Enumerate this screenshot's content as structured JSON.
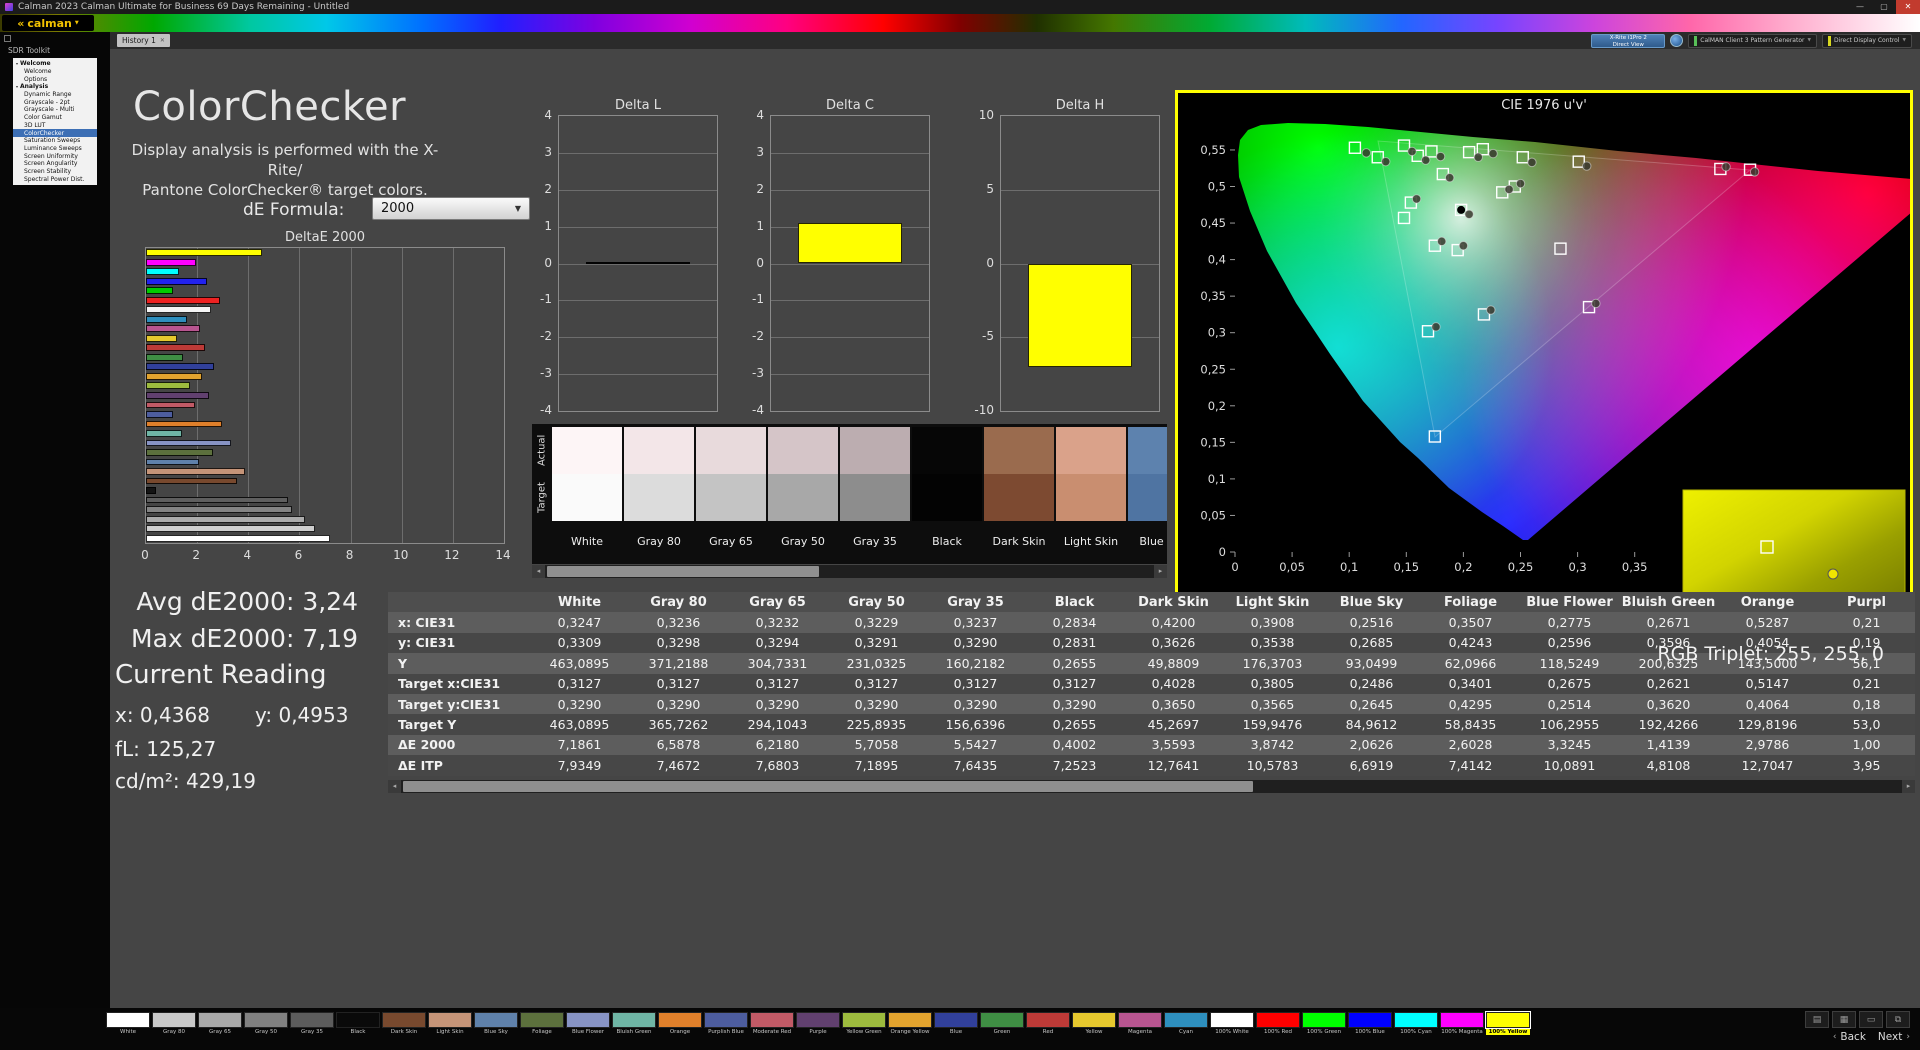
{
  "window": {
    "title": "Calman 2023 Calman Ultimate for Business 69 Days Remaining  -  Untitled",
    "minimize": "—",
    "maximize": "▢",
    "close": "✕",
    "logo_mark": "«",
    "logo_text": "calman",
    "logo_caret": "▼"
  },
  "sidebar": {
    "title": "SDR Toolkit",
    "tree": [
      {
        "label": "Welcome",
        "type": "section"
      },
      {
        "label": "Welcome",
        "type": "item"
      },
      {
        "label": "Options",
        "type": "item"
      },
      {
        "label": "Analysis",
        "type": "section"
      },
      {
        "label": "Dynamic Range",
        "type": "item"
      },
      {
        "label": "Grayscale - 2pt",
        "type": "item"
      },
      {
        "label": "Grayscale - Multi",
        "type": "item"
      },
      {
        "label": "Color Gamut",
        "type": "item"
      },
      {
        "label": "3D LUT",
        "type": "item"
      },
      {
        "label": "ColorChecker",
        "type": "item",
        "selected": true
      },
      {
        "label": "Saturation Sweeps",
        "type": "item"
      },
      {
        "label": "Luminance Sweeps",
        "type": "item"
      },
      {
        "label": "Screen Uniformity",
        "type": "item"
      },
      {
        "label": "Screen Angularity",
        "type": "item"
      },
      {
        "label": "Screen Stability",
        "type": "item"
      },
      {
        "label": "Spectral Power Dist.",
        "type": "item"
      }
    ]
  },
  "topbar": {
    "tab": "History 1",
    "tab_close": "✕",
    "meter_line1": "X-Rite i1Pro 2",
    "meter_line2": "Direct View",
    "source_label": "CalMAN Client 3 Pattern Generator",
    "display_label": "Direct Display Control",
    "caret": "▼"
  },
  "page": {
    "title": "ColorChecker",
    "desc1": "Display analysis is performed with the X-Rite/",
    "desc2": "Pantone ColorChecker® target colors.",
    "formula_label": "dE Formula:",
    "formula_value": "2000",
    "formula_caret": "▼",
    "avg": "Avg dE2000: 3,24",
    "max": "Max dE2000: 7,19",
    "reading_title": "Current Reading",
    "reading_x": "x: 0,4368",
    "reading_y": "y: 0,4953",
    "reading_fl": "fL: 125,27",
    "reading_cd": "cd/m²: 429,19"
  },
  "chart_data": [
    {
      "id": "deltae2000",
      "type": "bar",
      "orientation": "horizontal",
      "title": "DeltaE 2000",
      "xlim": [
        0,
        14
      ],
      "xticks": [
        "0",
        "2",
        "4",
        "6",
        "8",
        "10",
        "12",
        "14"
      ],
      "bars": [
        {
          "name": "100% Yellow",
          "value": 4.55,
          "color": "#ffff00"
        },
        {
          "name": "100% Magenta",
          "value": 1.95,
          "color": "#ff00ff"
        },
        {
          "name": "100% Cyan",
          "value": 1.3,
          "color": "#00ffff"
        },
        {
          "name": "100% Blue",
          "value": 2.4,
          "color": "#2222ee"
        },
        {
          "name": "100% Green",
          "value": 1.05,
          "color": "#00cc00"
        },
        {
          "name": "100% Red",
          "value": 2.9,
          "color": "#ee2222"
        },
        {
          "name": "100% White",
          "value": 2.55,
          "color": "#f5f5f5"
        },
        {
          "name": "Cyan",
          "value": 1.6,
          "color": "#2e8fbe"
        },
        {
          "name": "Magenta",
          "value": 2.1,
          "color": "#b85590"
        },
        {
          "name": "Yellow",
          "value": 1.2,
          "color": "#e6c82e"
        },
        {
          "name": "Red",
          "value": 2.3,
          "color": "#bd3a37"
        },
        {
          "name": "Green",
          "value": 1.45,
          "color": "#3f8e44"
        },
        {
          "name": "Blue",
          "value": 2.65,
          "color": "#31409b"
        },
        {
          "name": "Orange Yellow",
          "value": 2.2,
          "color": "#e2a32e"
        },
        {
          "name": "Yellow Green",
          "value": 1.7,
          "color": "#9dbb3e"
        },
        {
          "name": "Purple",
          "value": 2.45,
          "color": "#61406f"
        },
        {
          "name": "Moderate Red",
          "value": 1.9,
          "color": "#c15a66"
        },
        {
          "name": "Purplish Blue",
          "value": 1.05,
          "color": "#4d5d9f"
        },
        {
          "name": "Orange",
          "value": 2.98,
          "color": "#e0802b"
        },
        {
          "name": "Bluish Green",
          "value": 1.41,
          "color": "#6fb5a5"
        },
        {
          "name": "Blue Flower",
          "value": 3.32,
          "color": "#8793c4"
        },
        {
          "name": "Foliage",
          "value": 2.6,
          "color": "#5c703d"
        },
        {
          "name": "Blue Sky",
          "value": 2.06,
          "color": "#5f81aa"
        },
        {
          "name": "Light Skin",
          "value": 3.87,
          "color": "#c59478"
        },
        {
          "name": "Dark Skin",
          "value": 3.56,
          "color": "#78492e"
        },
        {
          "name": "Black",
          "value": 0.4,
          "color": "#141414"
        },
        {
          "name": "Gray 35",
          "value": 5.54,
          "color": "#5f5f5f"
        },
        {
          "name": "Gray 50",
          "value": 5.71,
          "color": "#848484"
        },
        {
          "name": "Gray 65",
          "value": 6.22,
          "color": "#ababab"
        },
        {
          "name": "Gray 80",
          "value": 6.59,
          "color": "#cecece"
        },
        {
          "name": "White",
          "value": 7.19,
          "color": "#ffffff"
        }
      ]
    },
    {
      "id": "delta_l",
      "delta": true,
      "type": "bar",
      "title": "Delta L",
      "ylim": [
        -4,
        4
      ],
      "yticks": [
        "4",
        "3",
        "2",
        "1",
        "0",
        "-1",
        "-2",
        "-3",
        "-4"
      ],
      "value": 0.05,
      "bar_color": "#151515"
    },
    {
      "id": "delta_c",
      "delta": true,
      "type": "bar",
      "title": "Delta C",
      "ylim": [
        -4,
        4
      ],
      "yticks": [
        "4",
        "3",
        "2",
        "1",
        "0",
        "-1",
        "-2",
        "-3",
        "-4"
      ],
      "value": 1.1,
      "bar_color": "#ffff00"
    },
    {
      "id": "delta_h",
      "delta": true,
      "type": "bar",
      "title": "Delta H",
      "ylim": [
        -10,
        10
      ],
      "yticks": [
        "10",
        "5",
        "0",
        "-5",
        "-10"
      ],
      "value": -7.0,
      "bar_color": "#ffff00"
    },
    {
      "id": "cie",
      "type": "scatter",
      "title": "CIE 1976 u'v'",
      "x_ticks": [
        "0",
        "0,05",
        "0,1",
        "0,15",
        "0,2",
        "0,25",
        "0,3",
        "0,35",
        "0,4",
        "0,45",
        "0,5",
        "0,55"
      ],
      "y_ticks": [
        "0",
        "0,05",
        "0,1",
        "0,15",
        "0,2",
        "0,25",
        "0,3",
        "0,35",
        "0,4",
        "0,45",
        "0,5",
        "0,55"
      ],
      "targets": [
        [
          0.105,
          0.553
        ],
        [
          0.148,
          0.556
        ],
        [
          0.172,
          0.548
        ],
        [
          0.205,
          0.547
        ],
        [
          0.252,
          0.54
        ],
        [
          0.301,
          0.534
        ],
        [
          0.16,
          0.542
        ],
        [
          0.125,
          0.54
        ],
        [
          0.425,
          0.524
        ],
        [
          0.451,
          0.523
        ],
        [
          0.217,
          0.551
        ],
        [
          0.245,
          0.5
        ],
        [
          0.234,
          0.492
        ],
        [
          0.198,
          0.468
        ],
        [
          0.182,
          0.517
        ],
        [
          0.154,
          0.478
        ],
        [
          0.175,
          0.419
        ],
        [
          0.195,
          0.413
        ],
        [
          0.169,
          0.302
        ],
        [
          0.218,
          0.325
        ],
        [
          0.31,
          0.335
        ],
        [
          0.175,
          0.158
        ],
        [
          0.148,
          0.457
        ],
        [
          0.285,
          0.415
        ]
      ],
      "measured": [
        [
          0.115,
          0.546
        ],
        [
          0.155,
          0.548
        ],
        [
          0.18,
          0.541
        ],
        [
          0.213,
          0.54
        ],
        [
          0.26,
          0.533
        ],
        [
          0.308,
          0.528
        ],
        [
          0.167,
          0.536
        ],
        [
          0.132,
          0.534
        ],
        [
          0.43,
          0.527
        ],
        [
          0.455,
          0.52
        ],
        [
          0.226,
          0.545
        ],
        [
          0.25,
          0.504
        ],
        [
          0.24,
          0.496
        ],
        [
          0.205,
          0.462
        ],
        [
          0.188,
          0.512
        ],
        [
          0.159,
          0.483
        ],
        [
          0.181,
          0.425
        ],
        [
          0.2,
          0.419
        ],
        [
          0.176,
          0.308
        ],
        [
          0.224,
          0.331
        ],
        [
          0.316,
          0.34
        ]
      ],
      "white_point": [
        0.198,
        0.468
      ],
      "inset": {
        "square": [
          84,
          57
        ],
        "dot": [
          150,
          84
        ]
      },
      "rgb_triplet": "RGB Triplet: 255, 255, 0"
    }
  ],
  "swatch_strip": {
    "row_label_top": "Actual",
    "row_label_bottom": "Target",
    "swatches": [
      {
        "label": "White",
        "actual": "#fdf5f6",
        "target": "#fafafa"
      },
      {
        "label": "Gray 80",
        "actual": "#f3e6e8",
        "target": "#dcdcdc"
      },
      {
        "label": "Gray 65",
        "actual": "#e8dadc",
        "target": "#c4c4c4"
      },
      {
        "label": "Gray 50",
        "actual": "#d5c5c8",
        "target": "#a8a8a8"
      },
      {
        "label": "Gray 35",
        "actual": "#bcadb0",
        "target": "#8d8d8d"
      },
      {
        "label": "Black",
        "actual": "#060606",
        "target": "#030303"
      },
      {
        "label": "Dark Skin",
        "actual": "#9a6b4e",
        "target": "#7d4a31"
      },
      {
        "label": "Light Skin",
        "actual": "#daa28a",
        "target": "#c98e70"
      },
      {
        "label": "Blue Sky",
        "actual": "#5d82ae",
        "target": "#4f74a2"
      }
    ]
  },
  "table": {
    "columns": [
      "White",
      "Gray 80",
      "Gray 65",
      "Gray 50",
      "Gray 35",
      "Black",
      "Dark Skin",
      "Light Skin",
      "Blue Sky",
      "Foliage",
      "Blue Flower",
      "Bluish Green",
      "Orange",
      "Purpl"
    ],
    "rows": [
      {
        "label": "x: CIE31",
        "values": [
          "0,3247",
          "0,3236",
          "0,3232",
          "0,3229",
          "0,3237",
          "0,2834",
          "0,4200",
          "0,3908",
          "0,2516",
          "0,3507",
          "0,2775",
          "0,2671",
          "0,5287",
          "0,21"
        ]
      },
      {
        "label": "y: CIE31",
        "values": [
          "0,3309",
          "0,3298",
          "0,3294",
          "0,3291",
          "0,3290",
          "0,2831",
          "0,3626",
          "0,3538",
          "0,2685",
          "0,4243",
          "0,2596",
          "0,3596",
          "0,4054",
          "0,19"
        ]
      },
      {
        "label": "Y",
        "values": [
          "463,0895",
          "371,2188",
          "304,7331",
          "231,0325",
          "160,2182",
          "0,2655",
          "49,8809",
          "176,3703",
          "93,0499",
          "62,0966",
          "118,5249",
          "200,6325",
          "143,5000",
          "56,1"
        ]
      },
      {
        "label": "Target x:CIE31",
        "values": [
          "0,3127",
          "0,3127",
          "0,3127",
          "0,3127",
          "0,3127",
          "0,3127",
          "0,4028",
          "0,3805",
          "0,2486",
          "0,3401",
          "0,2675",
          "0,2621",
          "0,5147",
          "0,21"
        ]
      },
      {
        "label": "Target y:CIE31",
        "values": [
          "0,3290",
          "0,3290",
          "0,3290",
          "0,3290",
          "0,3290",
          "0,3290",
          "0,3650",
          "0,3565",
          "0,2645",
          "0,4295",
          "0,2514",
          "0,3620",
          "0,4064",
          "0,18"
        ]
      },
      {
        "label": "Target Y",
        "values": [
          "463,0895",
          "365,7262",
          "294,1043",
          "225,8935",
          "156,6396",
          "0,2655",
          "45,2697",
          "159,9476",
          "84,9612",
          "58,8435",
          "106,2955",
          "192,4266",
          "129,8196",
          "53,0"
        ]
      },
      {
        "label": "ΔE 2000",
        "values": [
          "7,1861",
          "6,5878",
          "6,2180",
          "5,7058",
          "5,5427",
          "0,4002",
          "3,5593",
          "3,8742",
          "2,0626",
          "2,6028",
          "3,3245",
          "1,4139",
          "2,9786",
          "1,00"
        ]
      },
      {
        "label": "ΔE ITP",
        "values": [
          "7,9349",
          "7,4672",
          "7,6803",
          "7,1895",
          "7,6435",
          "7,2523",
          "12,7641",
          "10,5783",
          "6,6919",
          "7,4142",
          "10,0891",
          "4,8108",
          "12,7047",
          "3,95"
        ]
      }
    ]
  },
  "patch_bar": {
    "patches": [
      {
        "label": "White",
        "color": "#ffffff"
      },
      {
        "label": "Gray 80",
        "color": "#c9c9c9"
      },
      {
        "label": "Gray 65",
        "color": "#a9a9a9"
      },
      {
        "label": "Gray 50",
        "color": "#808080"
      },
      {
        "label": "Gray 35",
        "color": "#5c5c5c"
      },
      {
        "label": "Black",
        "color": "#0a0a0a"
      },
      {
        "label": "Dark Skin",
        "color": "#78492e"
      },
      {
        "label": "Light Skin",
        "color": "#c59478"
      },
      {
        "label": "Blue Sky",
        "color": "#5f81aa"
      },
      {
        "label": "Foliage",
        "color": "#5c703d"
      },
      {
        "label": "Blue Flower",
        "color": "#8793c4"
      },
      {
        "label": "Bluish Green",
        "color": "#6fb5a5"
      },
      {
        "label": "Orange",
        "color": "#e0802b"
      },
      {
        "label": "Purplish Blue",
        "color": "#4d5d9f"
      },
      {
        "label": "Moderate Red",
        "color": "#c15a66"
      },
      {
        "label": "Purple",
        "color": "#61406f"
      },
      {
        "label": "Yellow Green",
        "color": "#9dbb3e"
      },
      {
        "label": "Orange Yellow",
        "color": "#e2a32e"
      },
      {
        "label": "Blue",
        "color": "#31409b"
      },
      {
        "label": "Green",
        "color": "#3f8e44"
      },
      {
        "label": "Red",
        "color": "#bd3a37"
      },
      {
        "label": "Yellow",
        "color": "#e6c82e"
      },
      {
        "label": "Magenta",
        "color": "#b85590"
      },
      {
        "label": "Cyan",
        "color": "#2e8fbe"
      },
      {
        "label": "100% White",
        "color": "#ffffff"
      },
      {
        "label": "100% Red",
        "color": "#ff0000"
      },
      {
        "label": "100% Green",
        "color": "#00ff00"
      },
      {
        "label": "100% Blue",
        "color": "#0000ff"
      },
      {
        "label": "100% Cyan",
        "color": "#00ffff"
      },
      {
        "label": "100% Magenta",
        "color": "#ff00ff"
      },
      {
        "label": "100% Yellow",
        "color": "#ffff00",
        "selected": true
      }
    ],
    "icons": [
      {
        "name": "pattern-window-icon",
        "glyph": "▤"
      },
      {
        "name": "grid-icon",
        "glyph": "▦"
      },
      {
        "name": "display-icon",
        "glyph": "▭"
      },
      {
        "name": "dual-display-icon",
        "glyph": "⧉"
      }
    ]
  },
  "nav": {
    "back": "Back",
    "next": "Next",
    "back_chev": "‹",
    "next_chev": "›"
  },
  "accent": {
    "panel_border": "#ffff00",
    "selection_blue": "#3d6fb5"
  }
}
